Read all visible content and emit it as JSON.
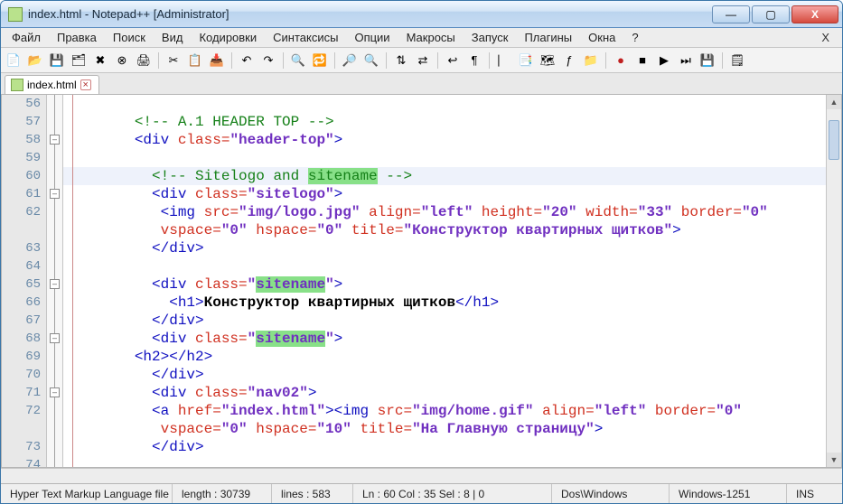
{
  "window": {
    "title": "index.html - Notepad++ [Administrator]"
  },
  "menubar": {
    "items": [
      "Файл",
      "Правка",
      "Поиск",
      "Вид",
      "Кодировки",
      "Синтаксисы",
      "Опции",
      "Макросы",
      "Запуск",
      "Плагины",
      "Окна",
      "?"
    ],
    "corner_x": "X"
  },
  "tabs": [
    {
      "label": "index.html"
    }
  ],
  "gutter": {
    "start": 56,
    "lines": [
      "56",
      "57",
      "58",
      "59",
      "60",
      "61",
      "62",
      "",
      "63",
      "64",
      "65",
      "66",
      "67",
      "68",
      "69",
      "70",
      "71",
      "72",
      "",
      "73",
      "74"
    ]
  },
  "code": {
    "l56": "",
    "l57_a": "<!-- A.1 HEADER TOP -->",
    "l58_open": "<div",
    "l58_class_attr": " class=",
    "l58_class_val": "\"header-top\"",
    "l58_close": ">",
    "l60_a": "<!-- Sitelogo and ",
    "l60_hl": "sitename",
    "l60_b": " -->",
    "l61_open": "<div",
    "l61_class_attr": " class=",
    "l61_class_val": "\"sitelogo\"",
    "l61_close": ">",
    "l62_open": "<img",
    "l62_src_attr": " src=",
    "l62_src_val": "\"img/logo.jpg\"",
    "l62_align_attr": " align=",
    "l62_align_val": "\"left\"",
    "l62_height_attr": " height=",
    "l62_height_val": "\"20\"",
    "l62_width_attr": " width=",
    "l62_width_val": "\"33\"",
    "l62_border_attr": " border=",
    "l62_border_val": "\"0\"",
    "l62b_vspace_attr": " vspace=",
    "l62b_vspace_val": "\"0\"",
    "l62b_hspace_attr": " hspace=",
    "l62b_hspace_val": "\"0\"",
    "l62b_title_attr": " title=",
    "l62b_title_val": "\"Конструктор квартирных щитков\"",
    "l62b_close": ">",
    "l63_close": "</div>",
    "l65_open": "<div",
    "l65_class_attr": " class=",
    "l65_class_valq1": "\"",
    "l65_class_hl": "sitename",
    "l65_class_valq2": "\"",
    "l65_close": ">",
    "l66_open": "<h1>",
    "l66_text": "Конструктор квартирных щитков",
    "l66_close": "</h1>",
    "l67_close": "</div>",
    "l68_open": "<div",
    "l68_class_attr": " class=",
    "l68_class_valq1": "\"",
    "l68_class_hl": "sitename",
    "l68_class_valq2": "\"",
    "l68_close": ">",
    "l69_open": "<h2>",
    "l69_close": "</h2>",
    "l70_close": "</div>",
    "l71_open": "<div",
    "l71_class_attr": " class=",
    "l71_class_val": "\"nav02\"",
    "l71_close": ">",
    "l72_a_open": "<a",
    "l72_href_attr": " href=",
    "l72_href_val": "\"index.html\"",
    "l72_a_close": ">",
    "l72_img_open": "<img",
    "l72_src_attr": " src=",
    "l72_src_val": "\"img/home.gif\"",
    "l72_align_attr": " align=",
    "l72_align_val": "\"left\"",
    "l72_border_attr": " border=",
    "l72_border_val": "\"0\"",
    "l72b_vspace_attr": " vspace=",
    "l72b_vspace_val": "\"0\"",
    "l72b_hspace_attr": " hspace=",
    "l72b_hspace_val": "\"10\"",
    "l72b_title_attr": " title=",
    "l72b_title_val": "\"На Главную страницу\"",
    "l72b_close": ">",
    "l73_close": "</div>"
  },
  "statusbar": {
    "lang": "Hyper Text Markup Language file",
    "length": "length : 30739",
    "lines": "lines : 583",
    "pos": "Ln : 60    Col : 35    Sel : 8 | 0",
    "eol": "Dos\\Windows",
    "enc": "Windows-1251",
    "mode": "INS"
  }
}
